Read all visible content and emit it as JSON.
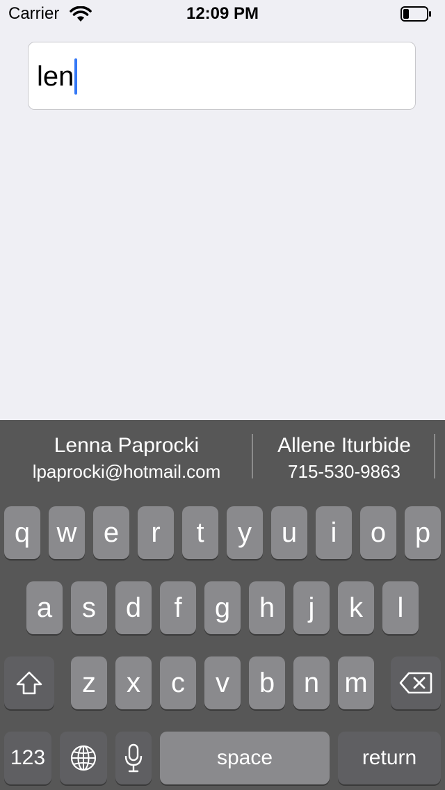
{
  "status_bar": {
    "carrier": "Carrier",
    "time": "12:09 PM",
    "battery_level": 0.25
  },
  "text_field": {
    "value": "len"
  },
  "suggestions": [
    {
      "name": "Lenna Paprocki",
      "detail": "lpaprocki@hotmail.com"
    },
    {
      "name": "Allene Iturbide",
      "detail": "715-530-9863"
    }
  ],
  "keyboard": {
    "row1": [
      "q",
      "w",
      "e",
      "r",
      "t",
      "y",
      "u",
      "i",
      "o",
      "p"
    ],
    "row2": [
      "a",
      "s",
      "d",
      "f",
      "g",
      "h",
      "j",
      "k",
      "l"
    ],
    "row3": [
      "z",
      "x",
      "c",
      "v",
      "b",
      "n",
      "m"
    ],
    "numbers_key": "123",
    "space_key": "space",
    "return_key": "return",
    "icons": {
      "shift": "shift-icon",
      "delete": "delete-icon",
      "globe": "globe-icon",
      "mic": "microphone-icon"
    },
    "colors": {
      "background": "#575757",
      "key": "#8a8a8d",
      "special_key": "#5f5f62",
      "caret": "#3478f6"
    }
  }
}
